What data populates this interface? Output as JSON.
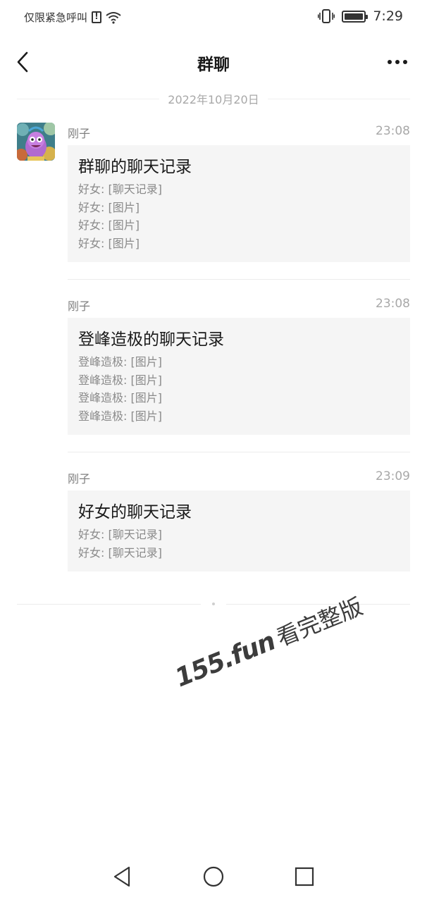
{
  "status_bar": {
    "carrier_text": "仅限紧急呼叫",
    "time": "7:29"
  },
  "nav": {
    "title": "群聊"
  },
  "date_header": "2022年10月20日",
  "messages": [
    {
      "sender": "刚子",
      "time": "23:08",
      "card_title": "群聊的聊天记录",
      "lines": [
        "好女: [聊天记录]",
        "好女: [图片]",
        "好女: [图片]",
        "好女: [图片]"
      ]
    },
    {
      "sender": "刚子",
      "time": "23:08",
      "card_title": "登峰造极的聊天记录",
      "lines": [
        "登峰造极: [图片]",
        "登峰造极: [图片]",
        "登峰造极: [图片]",
        "登峰造极: [图片]"
      ]
    },
    {
      "sender": "刚子",
      "time": "23:09",
      "card_title": "好女的聊天记录",
      "lines": [
        "好女: [聊天记录]",
        "好女: [聊天记录]"
      ]
    }
  ],
  "watermark": {
    "site": "155.fun",
    "text": "看完整版"
  },
  "icons": {
    "back": "chevron-left-icon",
    "more": "more-dots-icon",
    "wifi": "wifi-icon",
    "vibrate": "vibrate-icon",
    "battery": "battery-icon",
    "sim": "sim-alert-icon",
    "sys_back": "triangle-back-icon",
    "sys_home": "circle-home-icon",
    "sys_recent": "square-recent-icon"
  },
  "colors": {
    "card_bg": "#f5f5f5",
    "secondary_text": "#8a8a8a",
    "timestamp": "#a8a8a8"
  }
}
